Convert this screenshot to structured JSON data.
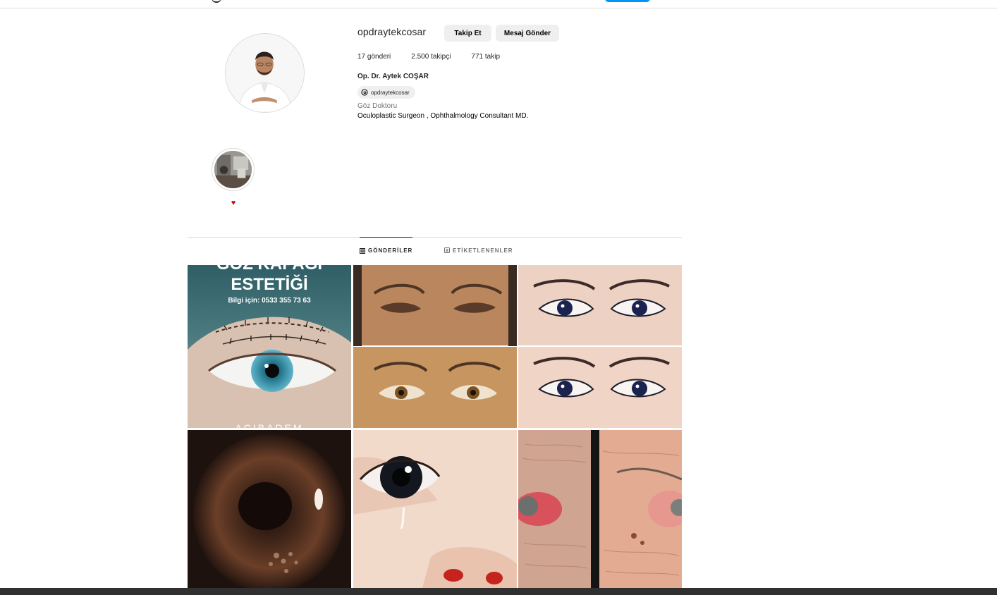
{
  "profile": {
    "username": "opdraytekcosar",
    "follow_label": "Takip Et",
    "message_label": "Mesaj Gönder",
    "posts_count": "17 gönderi",
    "followers_count": "2.500 takipçi",
    "following_count": "771 takip",
    "full_name": "Op. Dr. Aytek COŞAR",
    "threads_handle": "opdraytekcosar",
    "category": "Göz Doktoru",
    "bio": "Oculoplastic Surgeon , Ophthalmology Consultant MD."
  },
  "highlights": [
    {
      "label": "♥",
      "icon": "heart-icon"
    }
  ],
  "tabs": [
    {
      "label": "GÖNDERİLER",
      "icon": "grid-icon",
      "active": true
    },
    {
      "label": "ETİKETLENENLER",
      "icon": "tagged-icon",
      "active": false
    }
  ],
  "posts": [
    {
      "title": "GÖZ KAPAĞI",
      "subtitle": "ESTETİĞİ",
      "phone": "Bilgi için: 0533 355 73 63",
      "brand": "ACIBADEM"
    },
    {
      "kind": "eyelid before/after photo"
    },
    {
      "kind": "eyelid before/after photo"
    },
    {
      "kind": "iris close-up photo"
    },
    {
      "kind": "child eye with tear photo"
    },
    {
      "kind": "elderly eyelid photo"
    }
  ],
  "colors": {
    "accent": "#0095f6",
    "button_bg": "#efefef",
    "border": "#dbdbdb",
    "muted_text": "#737373",
    "heart": "#c21818"
  }
}
